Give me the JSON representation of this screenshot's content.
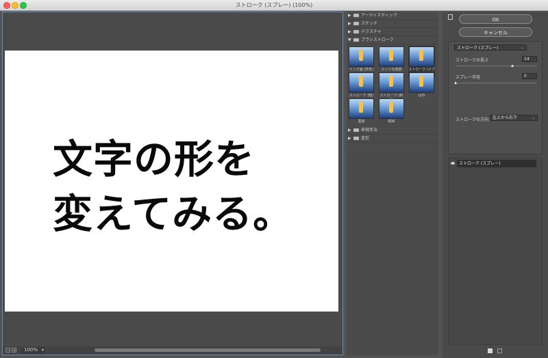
{
  "window": {
    "title": "ストローク (スプレー) (100%)"
  },
  "preview": {
    "canvas_text_line1": "文字の形を",
    "canvas_text_line2": "変えてみる。",
    "zoom_minus": "−",
    "zoom_plus": "+",
    "zoom_value": "100%"
  },
  "filter_gallery": {
    "categories_top": [
      {
        "label": "アーティスティック",
        "arrow": "▶"
      },
      {
        "label": "スケッチ",
        "arrow": "▶"
      },
      {
        "label": "テクスチャ",
        "arrow": "▶"
      },
      {
        "label": "ブラシストローク",
        "arrow": "▼"
      }
    ],
    "thumbnails": [
      {
        "label": "インク画 (外形)"
      },
      {
        "label": "エッジの強調"
      },
      {
        "label": "ストローク (スプレー)",
        "selected": true
      },
      {
        "label": "ストローク (暗)"
      },
      {
        "label": "ストローク (斜め)"
      },
      {
        "label": "はね"
      },
      {
        "label": "墨絵"
      },
      {
        "label": "網目"
      }
    ],
    "categories_bottom": [
      {
        "label": "表現手法",
        "arrow": "▶"
      },
      {
        "label": "変形",
        "arrow": "▶"
      }
    ]
  },
  "buttons": {
    "ok": "OK",
    "cancel": "キャンセル"
  },
  "settings": {
    "filter_select": "ストローク (スプレー)",
    "stroke_length_label": "ストロークの長さ",
    "stroke_length_value": "14",
    "stroke_length_fraction": 0.7,
    "spray_radius_label": "スプレー半径",
    "spray_radius_value": "0",
    "spray_radius_fraction": 0.0,
    "direction_label": "ストロークの方向：",
    "direction_value": "左上から右下"
  },
  "layers": {
    "items": [
      {
        "label": "ストローク (スプレー)"
      }
    ]
  },
  "colors": {
    "panel_bg": "#535353",
    "selection_border": "#6d8fbf"
  }
}
